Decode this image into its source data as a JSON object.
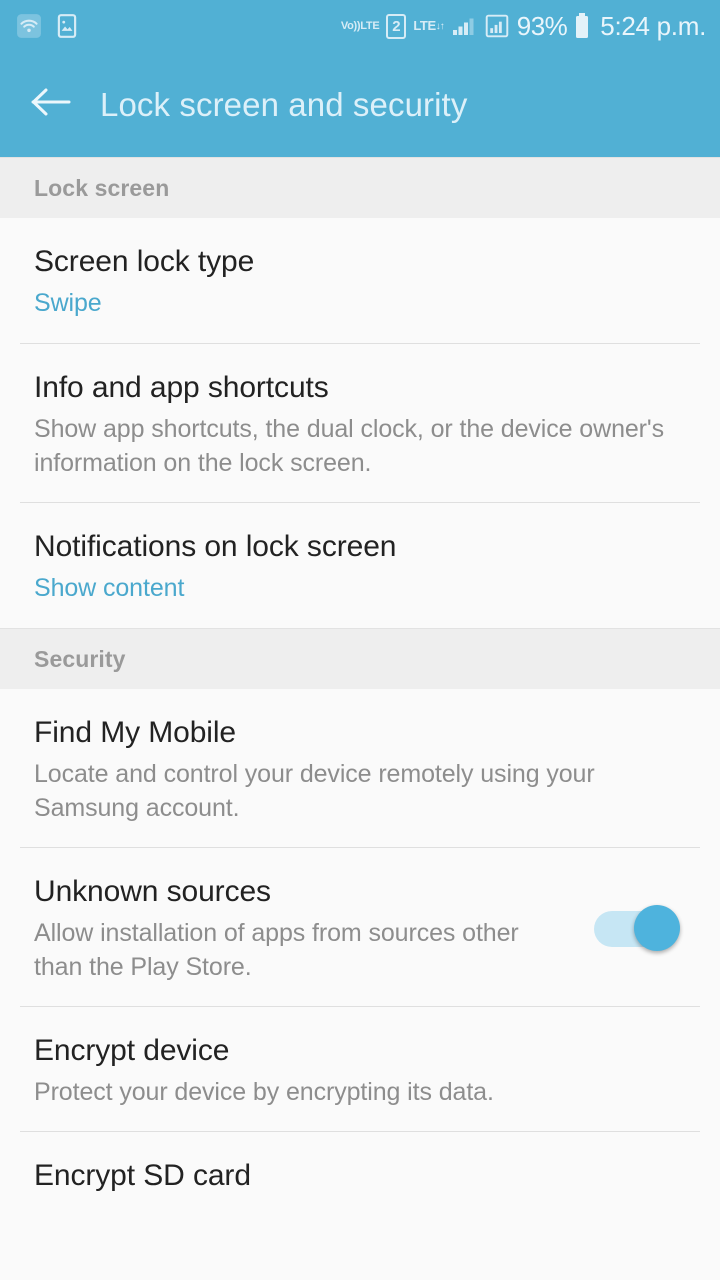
{
  "status_bar": {
    "left_icons": [
      {
        "name": "wifi-icon",
        "label": "Wi-Fi"
      },
      {
        "name": "screenshot-image-icon",
        "label": "Image"
      }
    ],
    "volte": {
      "top": "Vo))",
      "bottom": "LTE"
    },
    "sim_badge": "2",
    "lte": {
      "label": "LTE",
      "arrows": "↓↑"
    },
    "battery_percent": "93%",
    "time": "5:24 p.m."
  },
  "app_bar": {
    "title": "Lock screen and security",
    "back_icon": "arrow-left-icon"
  },
  "colors": {
    "accent_blue": "#4aa8cd",
    "header_blue": "#51b0d4",
    "toggle_thumb": "#4eb3dd",
    "toggle_track": "#c6e6f4",
    "title_text": "#222222",
    "secondary_text": "#8d8d8d",
    "section_header_text": "#9a9a9a",
    "page_background": "#fafafa",
    "section_background": "#eeeeee"
  },
  "sections": [
    {
      "header": "Lock screen",
      "items": [
        {
          "title": "Screen lock type",
          "value": "Swipe",
          "desc": null,
          "toggle": null
        },
        {
          "title": "Info and app shortcuts",
          "value": null,
          "desc": "Show app shortcuts, the dual clock, or the device owner's information on the lock screen.",
          "toggle": null
        },
        {
          "title": "Notifications on lock screen",
          "value": "Show content",
          "desc": null,
          "toggle": null
        }
      ]
    },
    {
      "header": "Security",
      "items": [
        {
          "title": "Find My Mobile",
          "value": null,
          "desc": "Locate and control your device remotely using your Samsung account.",
          "toggle": null
        },
        {
          "title": "Unknown sources",
          "value": null,
          "desc": "Allow installation of apps from sources other than the Play Store.",
          "toggle": {
            "state": "on"
          }
        },
        {
          "title": "Encrypt device",
          "value": null,
          "desc": "Protect your device by encrypting its data.",
          "toggle": null
        },
        {
          "title": "Encrypt SD card",
          "value": null,
          "desc": null,
          "toggle": null
        }
      ]
    }
  ]
}
